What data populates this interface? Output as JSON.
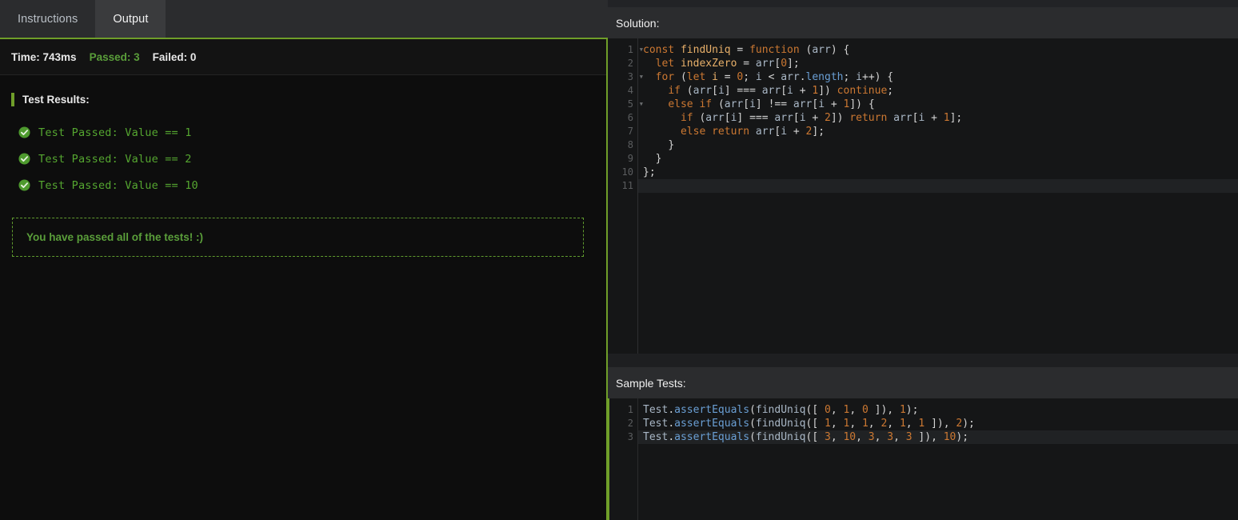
{
  "tabs": [
    {
      "label": "Instructions",
      "active": false
    },
    {
      "label": "Output",
      "active": true
    }
  ],
  "output": {
    "stats": {
      "time": "Time: 743ms",
      "passed": "Passed: 3",
      "failed": "Failed: 0"
    },
    "results_heading": "Test Results:",
    "tests": [
      {
        "icon": "check-circle-icon",
        "text": "Test Passed: Value == 1"
      },
      {
        "icon": "check-circle-icon",
        "text": "Test Passed: Value == 2"
      },
      {
        "icon": "check-circle-icon",
        "text": "Test Passed: Value == 10"
      }
    ],
    "pass_message": "You have passed all of the tests! :)"
  },
  "solution": {
    "title": "Solution:",
    "gutter": [
      {
        "n": "1",
        "fold": true
      },
      {
        "n": "2",
        "fold": false
      },
      {
        "n": "3",
        "fold": true
      },
      {
        "n": "4",
        "fold": false
      },
      {
        "n": "5",
        "fold": true
      },
      {
        "n": "6",
        "fold": false
      },
      {
        "n": "7",
        "fold": false
      },
      {
        "n": "8",
        "fold": false
      },
      {
        "n": "9",
        "fold": false
      },
      {
        "n": "10",
        "fold": false
      },
      {
        "n": "11",
        "fold": false
      }
    ],
    "lines": [
      "const findUniq = function (arr) {",
      "  let indexZero = arr[0];",
      "  for (let i = 0; i < arr.length; i++) {",
      "    if (arr[i] === arr[i + 1]) continue;",
      "    else if (arr[i] !== arr[i + 1]) {",
      "      if (arr[i] === arr[i + 2]) return arr[i + 1];",
      "      else return arr[i + 2];",
      "    }",
      "  }",
      "};",
      ""
    ],
    "active_line": 11
  },
  "sample_tests": {
    "title": "Sample Tests:",
    "gutter": [
      "1",
      "2",
      "3"
    ],
    "lines": [
      "Test.assertEquals(findUniq([ 0, 1, 0 ]), 1);",
      "Test.assertEquals(findUniq([ 1, 1, 1, 2, 1, 1 ]), 2);",
      "Test.assertEquals(findUniq([ 3, 10, 3, 3, 3 ]), 10);"
    ],
    "active_line": 3
  },
  "colors": {
    "accent_green": "#6f9e29",
    "pass_green": "#5a9e3a",
    "test_text_green": "#55a630",
    "editor_bg": "#151617",
    "panel_bg": "#2b2c2e",
    "output_bg": "#0d0d0d",
    "keyword_orange": "#cc7832",
    "identifier_blue": "#a9b7c6",
    "method_blue": "#6a9fd4"
  }
}
